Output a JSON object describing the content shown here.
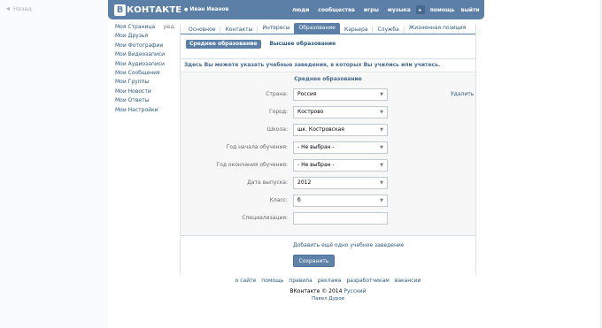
{
  "back": {
    "arrow": "◂",
    "label": "Назад"
  },
  "header": {
    "logo_letter": "В",
    "logo_text": "КОНТАКТЕ",
    "user_dot": "●",
    "user_name": "Иван Иванов",
    "nav": [
      "люди",
      "сообщества",
      "игры",
      "музыка"
    ],
    "more_arrow": "▸",
    "nav_after": [
      "помощь",
      "выйти"
    ]
  },
  "sidebar": {
    "items": [
      "Моя Страница",
      "Мои Друзья",
      "Мои Фотографии",
      "Мои Видеозаписи",
      "Мои Аудиозаписи",
      "Мои Сообщения",
      "Мои Группы",
      "Мои Новости",
      "Мои Ответы",
      "Мои Настройки"
    ],
    "edit_label": "ред."
  },
  "tabs": [
    "Основное",
    "Контакты",
    "Интересы",
    "Образование",
    "Карьера",
    "Служба",
    "Жизненная позиция"
  ],
  "active_tab": "Образование",
  "subtabs": [
    "Среднее образование",
    "Высшее образование"
  ],
  "info_text": "Здесь Вы можете указать учебные заведения, в которых Вы учились или учитесь.",
  "form": {
    "title": "Среднее образование",
    "remove_label": "Удалить",
    "caret": "▼",
    "fields": [
      {
        "label": "Страна:",
        "value": "Россия"
      },
      {
        "label": "Город:",
        "value": "Кострово"
      },
      {
        "label": "Школа:",
        "value": "шк. Костровская"
      },
      {
        "label": "Год начала обучения:",
        "value": "- Не выбран -"
      },
      {
        "label": "Год окончания обучения:",
        "value": "- Не выбран -"
      },
      {
        "label": "Дата выпуска:",
        "value": "2012"
      },
      {
        "label": "Класс:",
        "value": "б"
      },
      {
        "label": "Специализация:",
        "value": ""
      }
    ]
  },
  "add_link": "Добавить ещё одно учебное заведение",
  "save_label": "Сохранить",
  "footer": {
    "links": [
      "о сайте",
      "помощь",
      "правила",
      "реклама",
      "разработчикам",
      "вакансии"
    ],
    "copyright": "ВКонтакте © 2014",
    "lang": "Русский",
    "author": "Павел Дуров"
  }
}
